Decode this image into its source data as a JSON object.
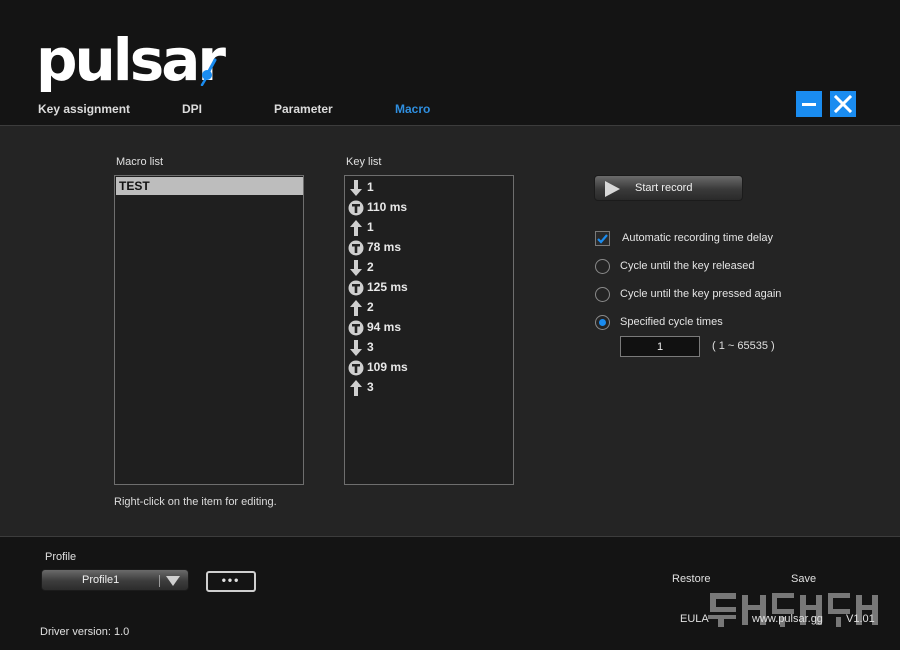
{
  "app": {
    "logo_text": "pulsar"
  },
  "tabs": [
    {
      "label": "Key assignment",
      "active": false
    },
    {
      "label": "DPI",
      "active": false
    },
    {
      "label": "Parameter",
      "active": false
    },
    {
      "label": "Macro",
      "active": true
    }
  ],
  "window_controls": {
    "minimize_icon": "minimize-icon",
    "close_icon": "close-icon"
  },
  "macro_list": {
    "label": "Macro list",
    "items": [
      "TEST"
    ],
    "selected": "TEST",
    "hint": "Right-click on the item for editing."
  },
  "key_list": {
    "label": "Key list",
    "items": [
      {
        "icon": "arrow-down-icon",
        "text": "1"
      },
      {
        "icon": "timer-icon",
        "text": "110 ms"
      },
      {
        "icon": "arrow-up-icon",
        "text": "1"
      },
      {
        "icon": "timer-icon",
        "text": "78 ms"
      },
      {
        "icon": "arrow-down-icon",
        "text": "2"
      },
      {
        "icon": "timer-icon",
        "text": "125 ms"
      },
      {
        "icon": "arrow-up-icon",
        "text": "2"
      },
      {
        "icon": "timer-icon",
        "text": "94 ms"
      },
      {
        "icon": "arrow-down-icon",
        "text": "3"
      },
      {
        "icon": "timer-icon",
        "text": "109 ms"
      },
      {
        "icon": "arrow-up-icon",
        "text": "3"
      }
    ]
  },
  "record": {
    "button_label": "Start record",
    "auto_delay_label": "Automatic recording time delay",
    "auto_delay_checked": true,
    "options": [
      {
        "label": "Cycle until the key released",
        "selected": false
      },
      {
        "label": "Cycle until the key pressed again",
        "selected": false
      },
      {
        "label": "Specified cycle times",
        "selected": true
      }
    ],
    "cycle_value": "1",
    "cycle_range": "( 1 ~ 65535 )"
  },
  "footer": {
    "profile_label": "Profile",
    "profile_selected": "Profile1",
    "more_label": "•••",
    "driver_version": "Driver version:  1.0",
    "restore_label": "Restore",
    "save_label": "Save",
    "eula_label": "EULA",
    "website": "www.pulsar.gg",
    "version": "V1.01"
  },
  "colors": {
    "accent": "#1a8cf0",
    "active_tab": "#2f8fe0",
    "panel": "#242424",
    "background": "#141414"
  }
}
